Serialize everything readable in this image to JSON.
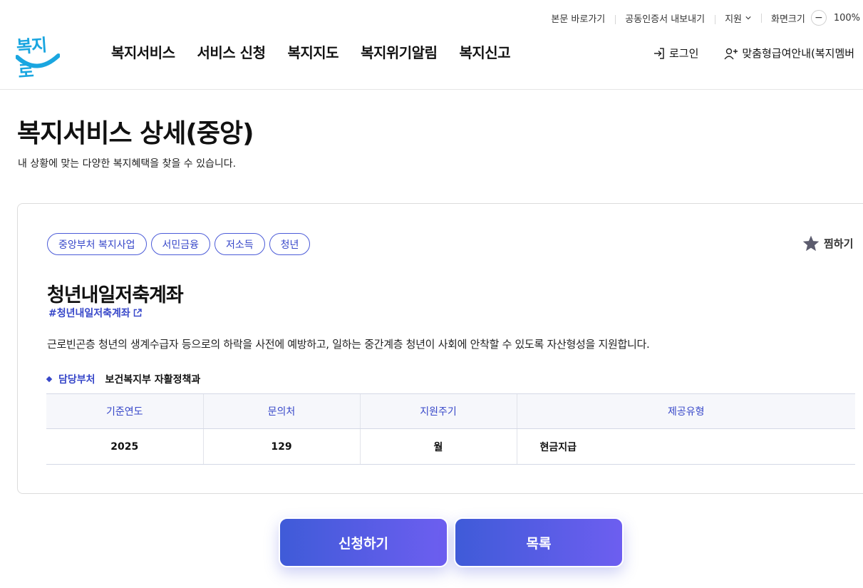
{
  "utility": {
    "skip_link": "본문 바로가기",
    "cert_export": "공동인증서 내보내기",
    "support": "지원",
    "screen_size_label": "화면크기",
    "zoom_minus": "−",
    "zoom_value": "100%"
  },
  "logo": {
    "text": "복지로"
  },
  "gnb": {
    "items": [
      "복지서비스",
      "서비스 신청",
      "복지지도",
      "복지위기알림",
      "복지신고"
    ]
  },
  "header_right": {
    "login": "로그인",
    "custom_guide": "맞춤형급여안내(복지멤버"
  },
  "page": {
    "title": "복지서비스 상세(중앙)",
    "subtitle": "내 상황에 맞는 다양한 복지혜택을 찾을 수 있습니다."
  },
  "service": {
    "tags": [
      "중앙부처 복지사업",
      "서민금융",
      "저소득",
      "청년"
    ],
    "favorite": "찜하기",
    "title": "청년내일저축계좌",
    "hashtag": "#청년내일저축계좌",
    "description": "근로빈곤층 청년의 생계수급자 등으로의 하락을 사전에 예방하고, 일하는 중간계층 청년이 사회에 안착할 수 있도록 자산형성을 지원합니다.",
    "dept_label": "담당부처",
    "dept_value": "보건복지부 자활정책과",
    "table": {
      "headers": [
        "기준연도",
        "문의처",
        "지원주기",
        "제공유형"
      ],
      "row": [
        "2025",
        "129",
        "월",
        "현금지급"
      ]
    }
  },
  "actions": {
    "apply": "신청하기",
    "list": "목록"
  },
  "colors": {
    "accent": "#3747c9",
    "logo": "#1aa6e0",
    "button_gradient_start": "#3f5bd8",
    "button_gradient_end": "#6d5ef0"
  }
}
